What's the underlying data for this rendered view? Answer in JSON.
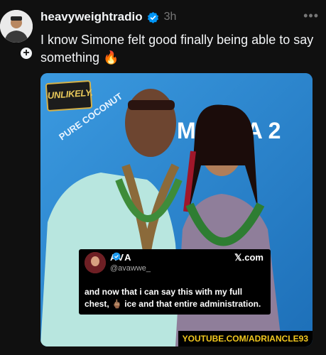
{
  "post": {
    "username": "heavyweightradio",
    "time": "3h",
    "more_label": "•••",
    "text": "I know Simone felt good finally being able to say something 🔥",
    "follow_label": "+"
  },
  "media": {
    "badge_text": "UNLIKELY.",
    "backdrop_words": [
      "PURE COCONUT",
      "MOANA 2"
    ],
    "tweet": {
      "name": "AVA",
      "handle": "@avawwe_",
      "x_label": "𝕏.com",
      "text": "and now that i can say this with my full chest, 🖕🏽 ice and that entire administration."
    },
    "watermark": "YOUTUBE.COM/ADRIANCLE93"
  },
  "colors": {
    "background": "#101010",
    "verified": "#0095f6",
    "backdrop": "#2a86cf",
    "watermark": "#f2c81e"
  }
}
